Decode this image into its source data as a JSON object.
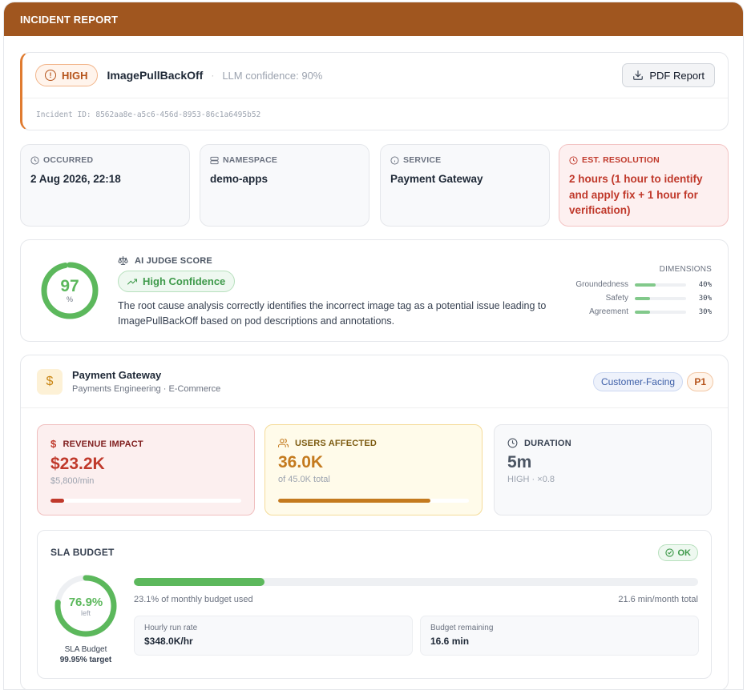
{
  "header": {
    "title": "INCIDENT REPORT"
  },
  "summary": {
    "severity": "HIGH",
    "title": "ImagePullBackOff",
    "separator": "·",
    "confidence": "LLM confidence: 90%",
    "pdf_label": "PDF Report",
    "incident_id": "Incident ID: 8562aa8e-a5c6-456d-8953-86c1a6495b52",
    "accent_color": "#e07b30"
  },
  "stats": [
    {
      "label": "OCCURRED",
      "value": "2 Aug 2026, 22:18",
      "icon": "clock-icon"
    },
    {
      "label": "NAMESPACE",
      "value": "demo-apps",
      "icon": "server-icon"
    },
    {
      "label": "SERVICE",
      "value": "Payment Gateway",
      "icon": "info-icon"
    },
    {
      "label": "EST. RESOLUTION",
      "value": "2 hours (1 hour to identify and apply fix + 1 hour for verification)",
      "icon": "clock-icon"
    }
  ],
  "judge": {
    "score": "97",
    "score_unit": "%",
    "score_value": 97,
    "label": "AI JUDGE SCORE",
    "badge": "High Confidence",
    "description": "The root cause analysis correctly identifies the incorrect image tag as a potential issue leading to ImagePullBackOff based on pod descriptions and annotations.",
    "dimensions_title": "DIMENSIONS",
    "dimensions": [
      {
        "name": "Groundedness",
        "pct": "40%",
        "value": 40
      },
      {
        "name": "Safety",
        "pct": "30%",
        "value": 30
      },
      {
        "name": "Agreement",
        "pct": "30%",
        "value": 30
      }
    ]
  },
  "service": {
    "icon_glyph": "$",
    "name": "Payment Gateway",
    "subtitle": "Payments Engineering · E-Commerce",
    "tag": "Customer-Facing",
    "priority": "P1",
    "metrics": [
      {
        "label": "REVENUE IMPACT",
        "icon_glyph": "$",
        "value": "$23.2K",
        "sub": "$5,800/min",
        "progress": 7,
        "bar_color": "#c0392b"
      },
      {
        "label": "USERS AFFECTED",
        "icon_glyph": "👥",
        "value": "36.0K",
        "sub": "of 45.0K total",
        "progress": 80,
        "bar_color": "#c47a1e"
      },
      {
        "label": "DURATION",
        "icon_glyph": "◷",
        "value": "5m",
        "sub": "HIGH · ×0.8"
      }
    ]
  },
  "sla": {
    "title": "SLA BUDGET",
    "status": "OK",
    "ring_value": "76.9%",
    "ring_sub": "left",
    "ring_fraction": 76.9,
    "caption_1": "SLA Budget",
    "caption_2": "99.95% target",
    "used_pct": 23.1,
    "used_label": "23.1% of monthly budget used",
    "total_label": "21.6 min/month total",
    "hourly_label": "Hourly run rate",
    "hourly_value": "$348.0K/hr",
    "remaining_label": "Budget remaining",
    "remaining_value": "16.6 min"
  }
}
